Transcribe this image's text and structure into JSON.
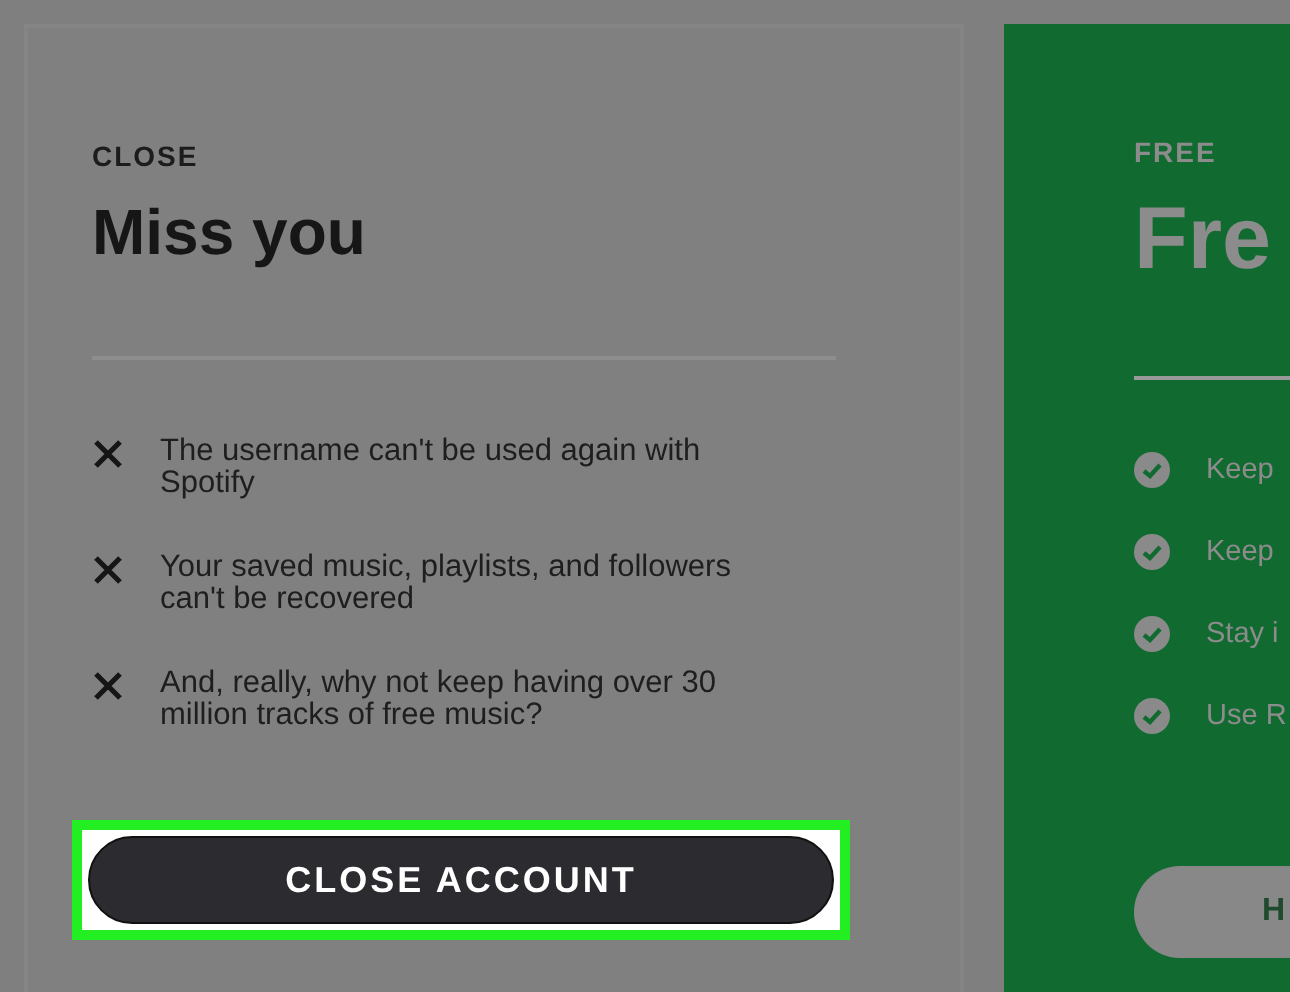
{
  "close_card": {
    "eyebrow": "CLOSE",
    "title": "Miss you",
    "items": [
      "The username can't be used again with Spotify",
      "Your saved music, playlists, and followers can't be recovered",
      "And, really, why not keep having over 30 million tracks of free music?"
    ],
    "button": {
      "label": "CLOSE ACCOUNT",
      "highlighted": true
    }
  },
  "free_card": {
    "eyebrow": "FREE",
    "title": "Fre",
    "features": [
      "Keep",
      "Keep",
      "Stay i",
      "Use R"
    ],
    "button": {
      "label": "H"
    }
  }
}
